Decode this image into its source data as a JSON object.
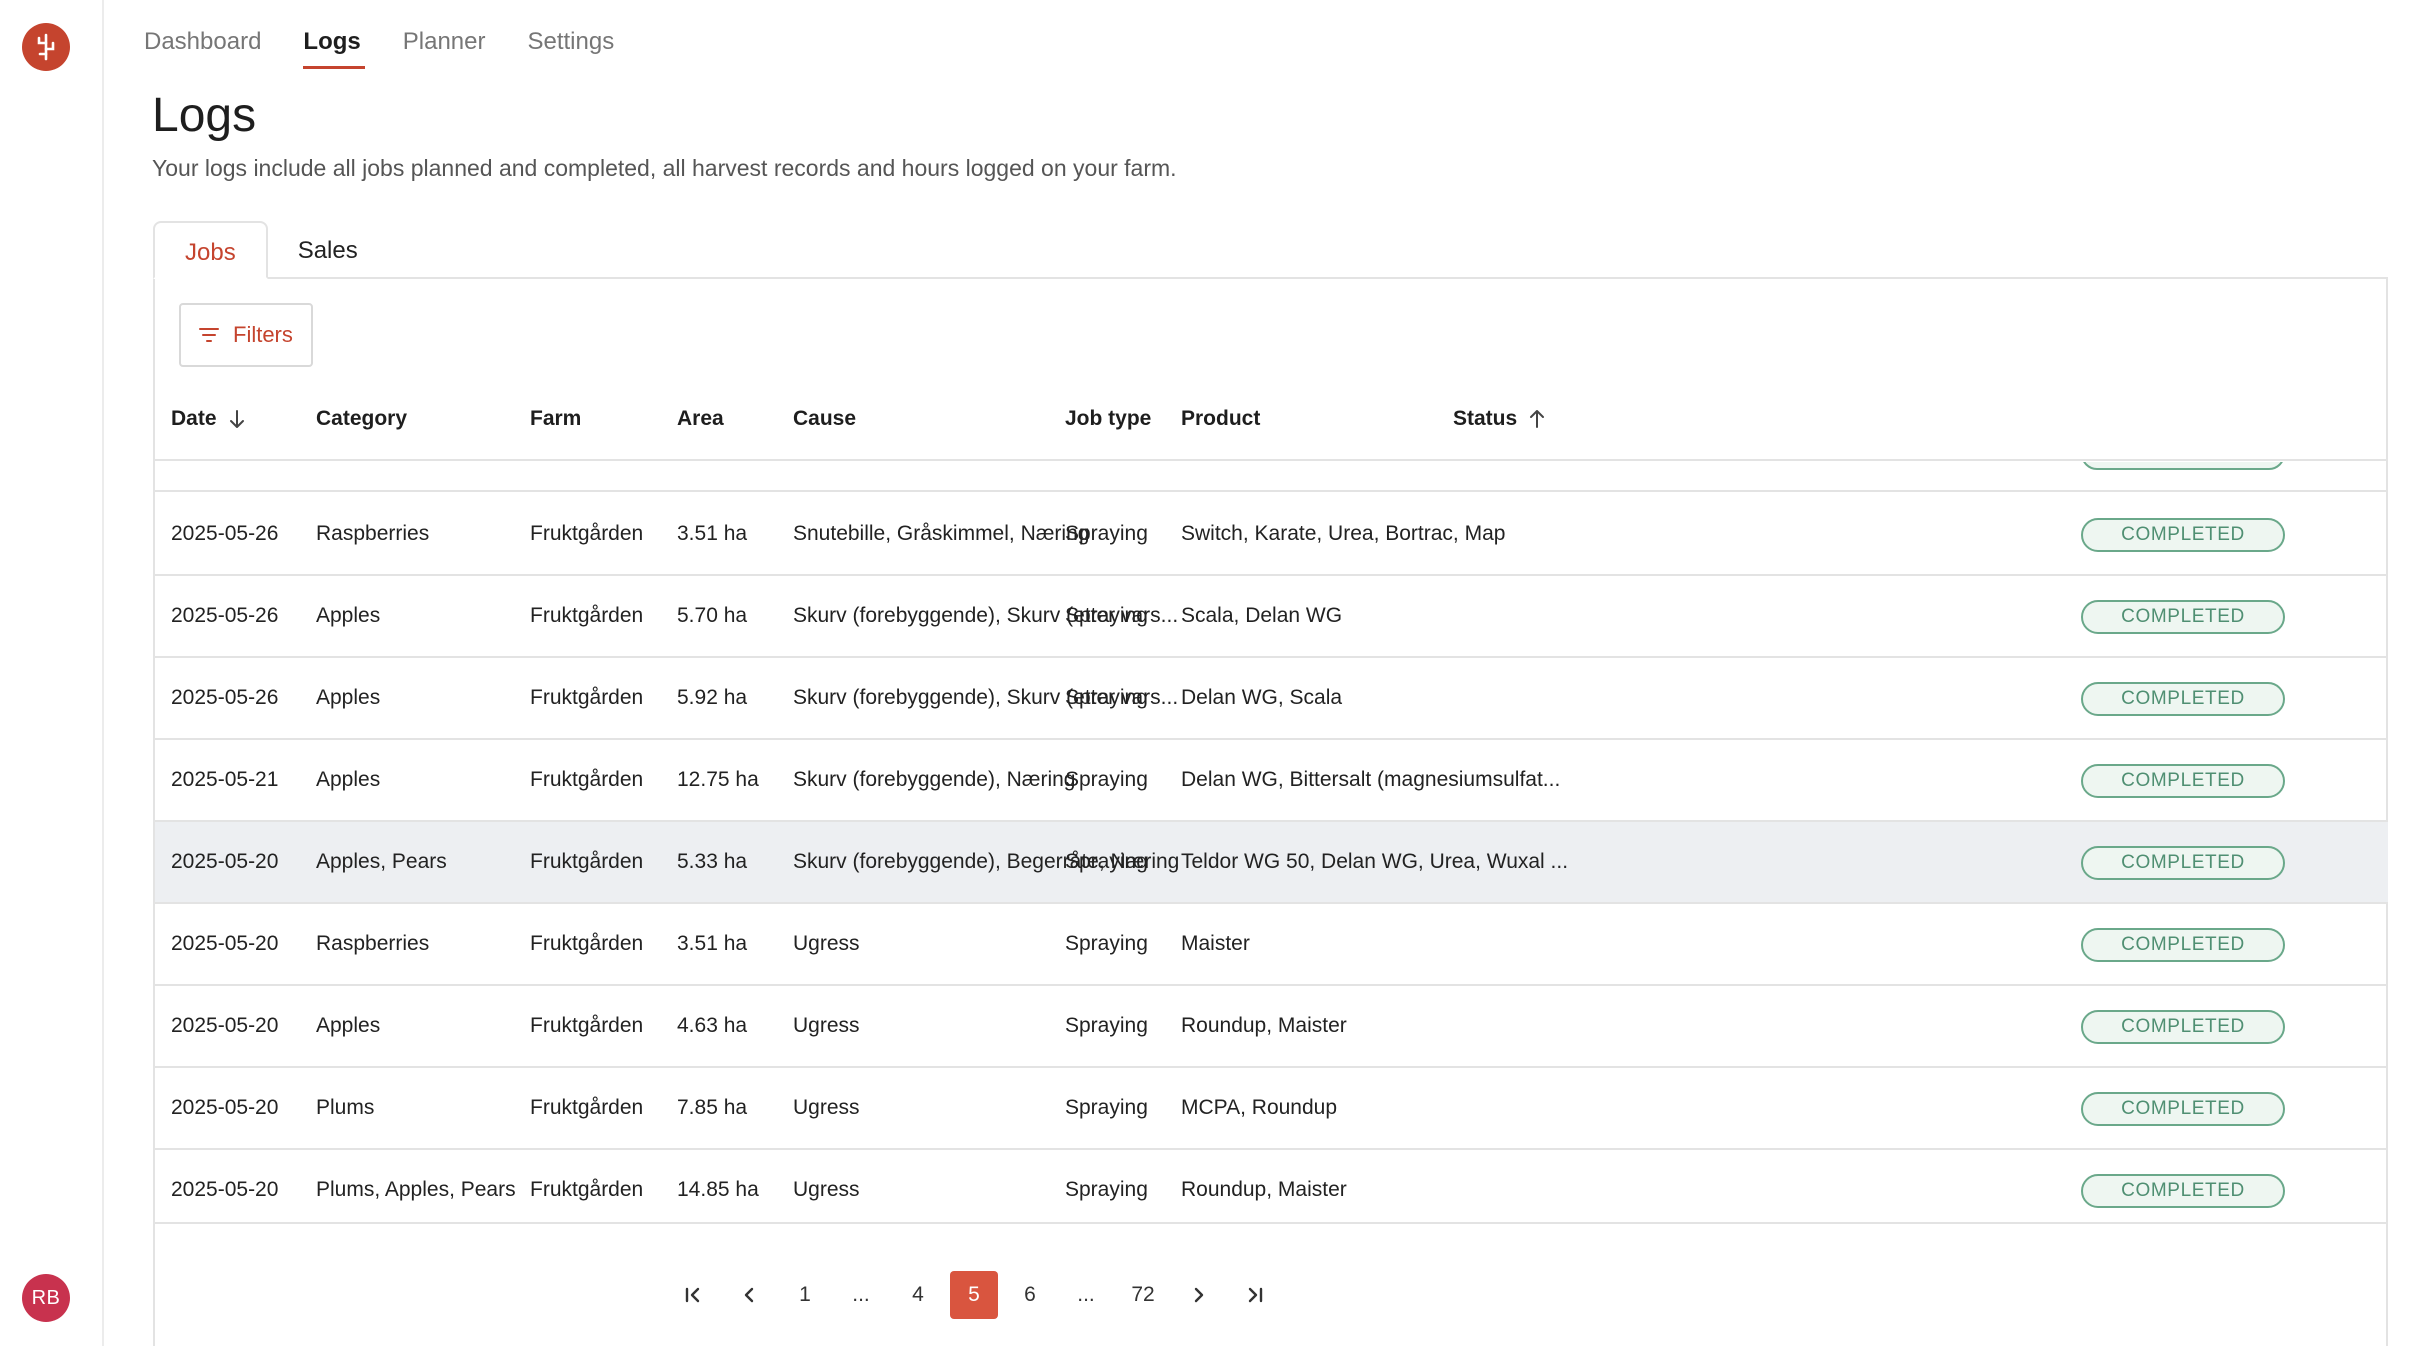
{
  "user": {
    "initials": "RB"
  },
  "nav": [
    {
      "label": "Dashboard",
      "active": false
    },
    {
      "label": "Logs",
      "active": true
    },
    {
      "label": "Planner",
      "active": false
    },
    {
      "label": "Settings",
      "active": false
    }
  ],
  "page": {
    "title": "Logs",
    "description": "Your logs include all jobs planned and completed, all harvest records and hours logged on your farm."
  },
  "tabs": [
    {
      "label": "Jobs",
      "active": true
    },
    {
      "label": "Sales",
      "active": false
    }
  ],
  "filters": {
    "label": "Filters",
    "icon": "filter-icon"
  },
  "table": {
    "columns": [
      {
        "label": "Date",
        "sort": "desc"
      },
      {
        "label": "Category"
      },
      {
        "label": "Farm"
      },
      {
        "label": "Area"
      },
      {
        "label": "Cause"
      },
      {
        "label": "Job type"
      },
      {
        "label": "Product"
      },
      {
        "label": "Status",
        "sort": "asc"
      }
    ],
    "rows": [
      {
        "date": "2025-05-26",
        "category": "Raspberries",
        "farm": "Fruktgården",
        "area": "3.51 ha",
        "cause": "Snutebille, Gråskimmel, Næring",
        "job_type": "Spraying",
        "product": "Switch, Karate, Urea, Bortrac, Map",
        "status": "COMPLETED"
      },
      {
        "date": "2025-05-26",
        "category": "Apples",
        "farm": "Fruktgården",
        "area": "5.70 ha",
        "cause": "Skurv (forebyggende), Skurv (etter vars...",
        "job_type": "Spraying",
        "product": "Scala, Delan WG",
        "status": "COMPLETED"
      },
      {
        "date": "2025-05-26",
        "category": "Apples",
        "farm": "Fruktgården",
        "area": "5.92 ha",
        "cause": "Skurv (forebyggende), Skurv (etter vars...",
        "job_type": "Spraying",
        "product": "Delan WG, Scala",
        "status": "COMPLETED"
      },
      {
        "date": "2025-05-21",
        "category": "Apples",
        "farm": "Fruktgården",
        "area": "12.75 ha",
        "cause": "Skurv (forebyggende), Næring",
        "job_type": "Spraying",
        "product": "Delan WG, Bittersalt (magnesiumsulfat...",
        "status": "COMPLETED"
      },
      {
        "date": "2025-05-20",
        "category": "Apples, Pears",
        "farm": "Fruktgården",
        "area": "5.33 ha",
        "cause": "Skurv (forebyggende), Begerråte, Næring",
        "job_type": "Spraying",
        "product": "Teldor WG 50, Delan WG, Urea, Wuxal ...",
        "status": "COMPLETED",
        "highlighted": true
      },
      {
        "date": "2025-05-20",
        "category": "Raspberries",
        "farm": "Fruktgården",
        "area": "3.51 ha",
        "cause": "Ugress",
        "job_type": "Spraying",
        "product": "Maister",
        "status": "COMPLETED"
      },
      {
        "date": "2025-05-20",
        "category": "Apples",
        "farm": "Fruktgården",
        "area": "4.63 ha",
        "cause": "Ugress",
        "job_type": "Spraying",
        "product": "Roundup, Maister",
        "status": "COMPLETED"
      },
      {
        "date": "2025-05-20",
        "category": "Plums",
        "farm": "Fruktgården",
        "area": "7.85 ha",
        "cause": "Ugress",
        "job_type": "Spraying",
        "product": "MCPA, Roundup",
        "status": "COMPLETED"
      },
      {
        "date": "2025-05-20",
        "category": "Plums, Apples, Pears",
        "farm": "Fruktgården",
        "area": "14.85 ha",
        "cause": "Ugress",
        "job_type": "Spraying",
        "product": "Roundup, Maister",
        "status": "COMPLETED"
      }
    ]
  },
  "pagination": {
    "items": [
      {
        "kind": "first",
        "icon": "first-page-icon"
      },
      {
        "kind": "prev",
        "icon": "chevron-left-icon"
      },
      {
        "kind": "page",
        "label": "1"
      },
      {
        "kind": "ellipsis",
        "label": "..."
      },
      {
        "kind": "page",
        "label": "4"
      },
      {
        "kind": "page",
        "label": "5",
        "active": true
      },
      {
        "kind": "page",
        "label": "6"
      },
      {
        "kind": "ellipsis",
        "label": "..."
      },
      {
        "kind": "page",
        "label": "72"
      },
      {
        "kind": "next",
        "icon": "chevron-right-icon"
      },
      {
        "kind": "last",
        "icon": "last-page-icon"
      }
    ]
  },
  "colors": {
    "accent": "#c5442e",
    "status_completed_border": "#6aa88a",
    "status_completed_text": "#4f8f72",
    "active_page": "#d9553f",
    "avatar": "#c8324e"
  }
}
